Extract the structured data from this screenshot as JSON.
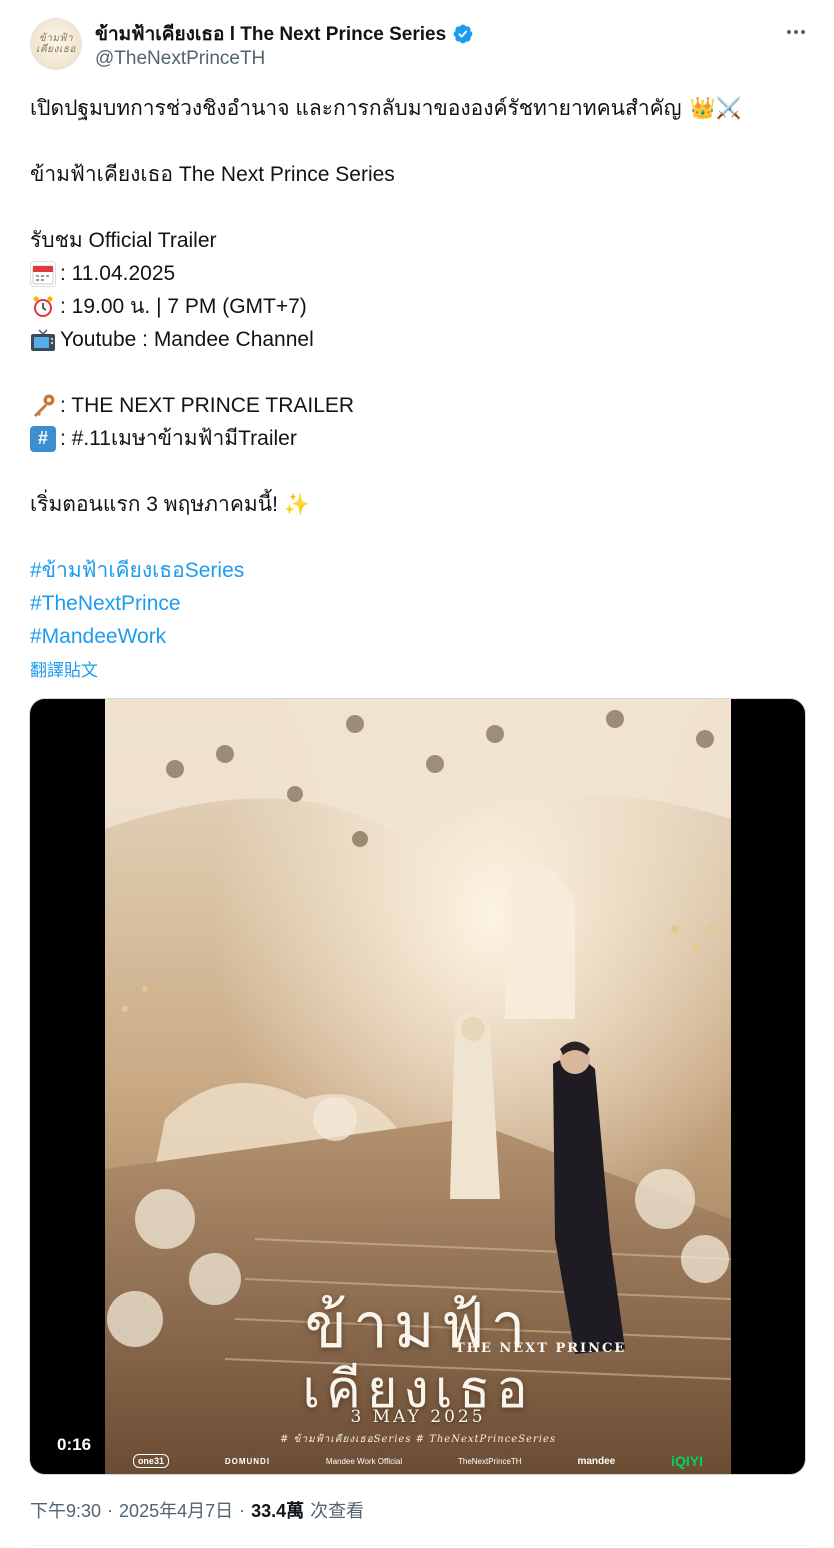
{
  "author": {
    "display_name": "ข้ามฟ้าเคียงเธอ l The Next Prince Series",
    "handle": "@TheNextPrinceTH",
    "avatar_text": "ข้ามฟ้า เคียงเธอ",
    "verified": true
  },
  "post": {
    "line1": "เปิดปฐมบทการช่วงชิงอำนาจ และการกลับมาขององค์รัชทายาทคนสำคัญ",
    "line1_emojis": "👑⚔️",
    "line2": "ข้ามฟ้าเคียงเธอ The Next Prince Series",
    "line3": "รับชม Official Trailer",
    "date_line": ": 11.04.2025",
    "time_line": ": 19.00 น. | 7 PM (GMT+7)",
    "channel_line": "Youtube : Mandee Channel",
    "key_line": ": THE NEXT PRINCE TRAILER",
    "hashtag_line": ": #.11เมษาข้ามฟ้ามีTrailer",
    "premiere_line": "เริ่มตอนแรก 3 พฤษภาคมนี้!",
    "hashtags": [
      "#ข้ามฟ้าเคียงเธอSeries",
      "#TheNextPrince",
      "#MandeeWork"
    ],
    "translate": "翻譯貼文"
  },
  "emojis": {
    "calendar": "calendar-icon",
    "alarm": "alarm-clock-icon",
    "tv": "television-icon",
    "key": "key-icon",
    "hash": "hash-keycap-icon",
    "sparkles": "✨"
  },
  "video": {
    "duration": "0:16",
    "poster": {
      "title_line1": "ข้ามฟ้า",
      "title_line2": "เคียงเธอ",
      "subtitle": "THE NEXT PRINCE",
      "date": "3 MAY 2025",
      "tags": "# ข้ามฟ้าเคียงเธอSeries   # TheNextPrinceSeries",
      "footer": {
        "one31": "one31",
        "domundi": "DOMUNDI",
        "mandee_official": "Mandee Work Official",
        "twitter": "TheNextPrinceTH",
        "mandee_logo": "mandee",
        "iqiyi": "iQIYI"
      }
    }
  },
  "meta": {
    "time": "下午9:30",
    "date": "2025年4月7日",
    "views": "33.4萬",
    "views_label": "次查看",
    "separator": "·"
  },
  "colors": {
    "link": "#1d9bf0",
    "secondary_text": "#536471",
    "verified": "#1d9bf0"
  }
}
